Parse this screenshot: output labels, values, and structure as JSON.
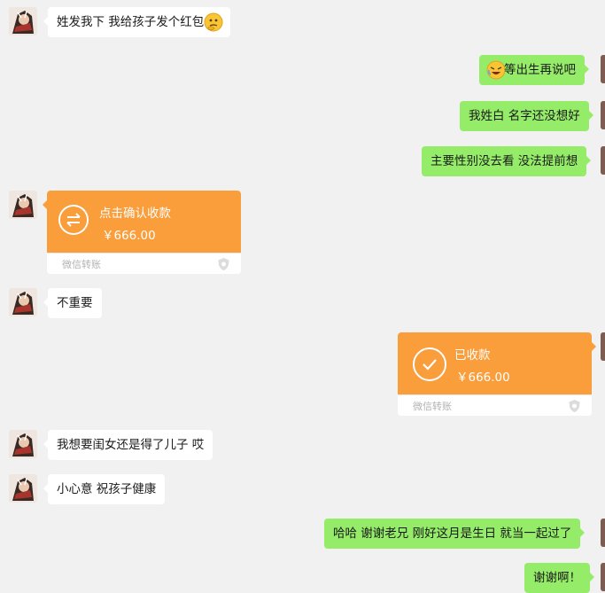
{
  "messages": [
    {
      "side": "left",
      "text": "姓发我下 我给孩子发个红包",
      "emoji": "thinking-face-icon"
    },
    {
      "side": "right",
      "text": "等出生再说吧",
      "emoji": "rolling-on-floor-laughing-icon"
    },
    {
      "side": "right",
      "text": "我姓白 名字还没想好"
    },
    {
      "side": "right",
      "text": "主要性别没去看 没法提前想"
    },
    {
      "side": "left",
      "type": "transfer",
      "title": "点击确认收款",
      "amount": "￥666.00",
      "label": "微信转账",
      "icon": "transfer-arrows-icon"
    },
    {
      "side": "left",
      "text": "不重要"
    },
    {
      "side": "right",
      "type": "transfer",
      "title": "已收款",
      "amount": "￥666.00",
      "label": "微信转账",
      "icon": "checkmark-icon"
    },
    {
      "side": "left",
      "text": "我想要闺女还是得了儿子 哎"
    },
    {
      "side": "left",
      "text": "小心意 祝孩子健康"
    },
    {
      "side": "right",
      "text": "哈哈 谢谢老兄 刚好这月是生日  就当一起过了"
    },
    {
      "side": "right",
      "text": "谢谢啊！"
    }
  ],
  "colors": {
    "background": "#f1f1f1",
    "left_bubble": "#ffffff",
    "right_bubble": "#95ec69",
    "transfer": "#fa9d3b"
  }
}
